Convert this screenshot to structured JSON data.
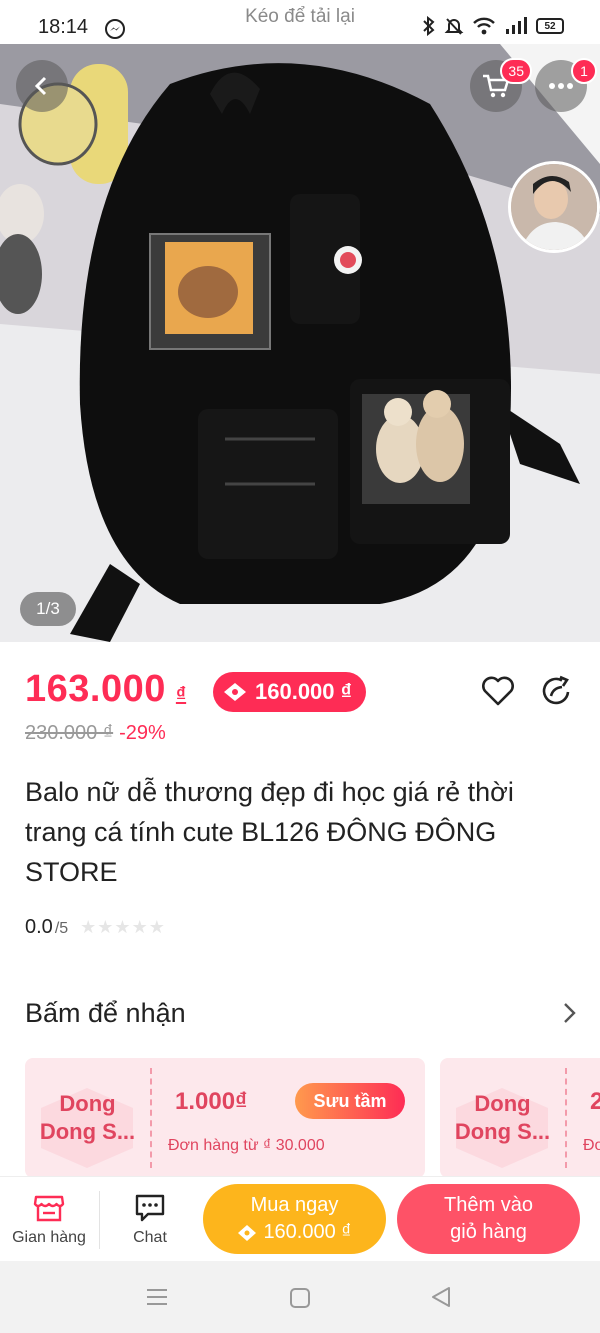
{
  "status_bar": {
    "time": "18:14",
    "pull_to_refresh": "Kéo để tải lại",
    "battery": "52"
  },
  "hero": {
    "image_counter": "1/3",
    "cart_badge": "35",
    "more_badge": "1"
  },
  "product": {
    "price": "163.000",
    "currency": "₫",
    "voucher_price": "160.000 ₫",
    "original_price": "230.000 ₫",
    "discount": "-29%",
    "title": "Balo nữ dễ thương đẹp đi học giá rẻ thời trang cá tính cute BL126 ĐÔNG ĐÔNG STORE",
    "rating": "0.0",
    "rating_max": "/5",
    "stars": "★★★★★"
  },
  "vouchers_section": {
    "title": "Bấm để nhận",
    "cards": [
      {
        "shop_line1": "Dong",
        "shop_line2": "Dong S...",
        "amount": "1.000₫",
        "condition": "Đơn hàng từ ₫ 30.000",
        "button": "Sưu tầm"
      },
      {
        "shop_line1": "Dong",
        "shop_line2": "Dong S...",
        "amount": "2",
        "condition": "Đơ"
      }
    ]
  },
  "bottom_bar": {
    "shop_label": "Gian hàng",
    "chat_label": "Chat",
    "buy_now_line1": "Mua ngay",
    "buy_now_line2": "160.000 ₫",
    "add_cart_line1": "Thêm vào",
    "add_cart_line2": "giỏ hàng"
  },
  "colors": {
    "accent": "#fe2c55",
    "buy_now": "#fdb51c",
    "add_cart": "#fe5267"
  }
}
